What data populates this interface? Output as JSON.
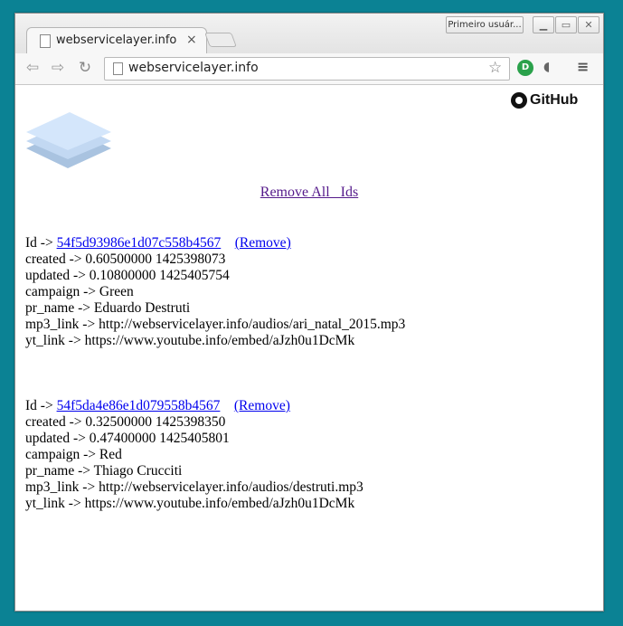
{
  "titlebar": {
    "profile_label": "Primeiro usuár..."
  },
  "tab": {
    "title": "webservicelayer.info",
    "close": "×"
  },
  "toolbar": {
    "url": "webservicelayer.info",
    "back": "⇦",
    "forward": "⇨",
    "reload": "↻",
    "star": "☆",
    "ext_label": "D",
    "ext2": "◖",
    "menu": "≡"
  },
  "colors": {
    "desktop": "#0b8294",
    "link": "#0000ee",
    "visited": "#551a8b"
  },
  "header": {
    "github_label": "GitHub"
  },
  "remove_all": {
    "label": "Remove All   Ids"
  },
  "records": [
    {
      "id_prefix": "Id -> ",
      "id_value": "54f5d93986e1d07c558b4567",
      "remove_label": "(Remove)",
      "created": "created -> 0.60500000 1425398073",
      "updated": "updated -> 0.10800000 1425405754",
      "campaign": "campaign -> Green",
      "pr_name": "pr_name -> Eduardo Destruti",
      "mp3_link": "mp3_link -> http://webservicelayer.info/audios/ari_natal_2015.mp3",
      "yt_link": "yt_link -> https://www.youtube.info/embed/aJzh0u1DcMk"
    },
    {
      "id_prefix": "Id -> ",
      "id_value": "54f5da4e86e1d079558b4567",
      "remove_label": "(Remove)",
      "created": "created -> 0.32500000 1425398350",
      "updated": "updated -> 0.47400000 1425405801",
      "campaign": "campaign -> Red",
      "pr_name": "pr_name -> Thiago Crucciti",
      "mp3_link": "mp3_link -> http://webservicelayer.info/audios/destruti.mp3",
      "yt_link": "yt_link -> https://www.youtube.info/embed/aJzh0u1DcMk"
    }
  ]
}
